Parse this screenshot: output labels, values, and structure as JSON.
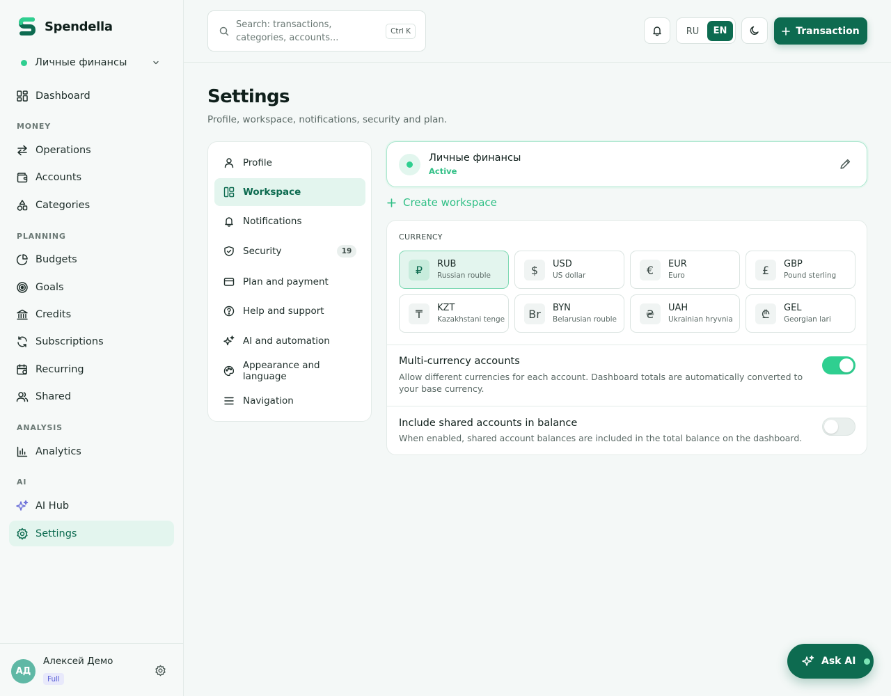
{
  "app": {
    "name": "Spendella"
  },
  "workspace_switcher": {
    "name": "Личные финансы"
  },
  "sidebar": {
    "dashboard": "Dashboard",
    "sections": {
      "money": "MONEY",
      "planning": "PLANNING",
      "analysis": "ANALYSIS",
      "ai": "AI"
    },
    "items": [
      {
        "label": "Operations",
        "icon": "arrows-exchange-icon"
      },
      {
        "label": "Accounts",
        "icon": "wallet-icon"
      },
      {
        "label": "Categories",
        "icon": "shapes-icon"
      },
      {
        "label": "Budgets",
        "icon": "pie-chart-icon"
      },
      {
        "label": "Goals",
        "icon": "target-icon"
      },
      {
        "label": "Credits",
        "icon": "bank-icon"
      },
      {
        "label": "Subscriptions",
        "icon": "refresh-icon"
      },
      {
        "label": "Recurring",
        "icon": "calendar-repeat-icon"
      },
      {
        "label": "Shared",
        "icon": "users-icon"
      },
      {
        "label": "Analytics",
        "icon": "bar-chart-icon"
      },
      {
        "label": "AI Hub",
        "icon": "sparkles-icon"
      },
      {
        "label": "Settings",
        "icon": "gear-icon"
      }
    ]
  },
  "user": {
    "initials": "АД",
    "name": "Алексей Демо",
    "plan": "Full"
  },
  "topbar": {
    "search_placeholder": "Search: transactions, categories, accounts...",
    "search_shortcut": "Ctrl K",
    "lang_ru": "RU",
    "lang_en": "EN",
    "active_lang": "EN",
    "add_transaction": "Transaction"
  },
  "page": {
    "title": "Settings",
    "subtitle": "Profile, workspace, notifications, security and plan."
  },
  "settings_nav": [
    {
      "label": "Profile",
      "icon": "user-icon"
    },
    {
      "label": "Workspace",
      "icon": "layout-icon",
      "active": true
    },
    {
      "label": "Notifications",
      "icon": "bell-icon"
    },
    {
      "label": "Security",
      "icon": "shield-icon",
      "count": "19"
    },
    {
      "label": "Plan and payment",
      "icon": "credit-card-icon"
    },
    {
      "label": "Help and support",
      "icon": "help-circle-icon"
    },
    {
      "label": "AI and automation",
      "icon": "sparkles-icon"
    },
    {
      "label": "Appearance and language",
      "icon": "palette-icon"
    },
    {
      "label": "Navigation",
      "icon": "menu-icon"
    }
  ],
  "workspace_card": {
    "name": "Личные финансы",
    "status": "Active"
  },
  "create_workspace": "Create workspace",
  "currency": {
    "title": "CURRENCY",
    "selected": "RUB",
    "items": [
      {
        "symbol": "₽",
        "code": "RUB",
        "name": "Russian rouble"
      },
      {
        "symbol": "$",
        "code": "USD",
        "name": "US dollar"
      },
      {
        "symbol": "€",
        "code": "EUR",
        "name": "Euro"
      },
      {
        "symbol": "£",
        "code": "GBP",
        "name": "Pound sterling"
      },
      {
        "symbol": "₸",
        "code": "KZT",
        "name": "Kazakhstani tenge"
      },
      {
        "symbol": "Br",
        "code": "BYN",
        "name": "Belarusian rouble"
      },
      {
        "symbol": "₴",
        "code": "UAH",
        "name": "Ukrainian hryvnia"
      },
      {
        "symbol": "₾",
        "code": "GEL",
        "name": "Georgian lari"
      }
    ]
  },
  "options": {
    "multi_currency": {
      "title": "Multi-currency accounts",
      "desc": "Allow different currencies for each account. Dashboard totals are automatically converted to your base currency.",
      "enabled": true
    },
    "shared_balance": {
      "title": "Include shared accounts in balance",
      "desc": "When enabled, shared account balances are included in the total balance on the dashboard.",
      "enabled": false
    }
  },
  "ask_ai": {
    "label": "Ask AI"
  },
  "colors": {
    "accent": "#0d6b50",
    "accent_light": "#2fcf90",
    "active_bg": "#e3f5ee"
  }
}
